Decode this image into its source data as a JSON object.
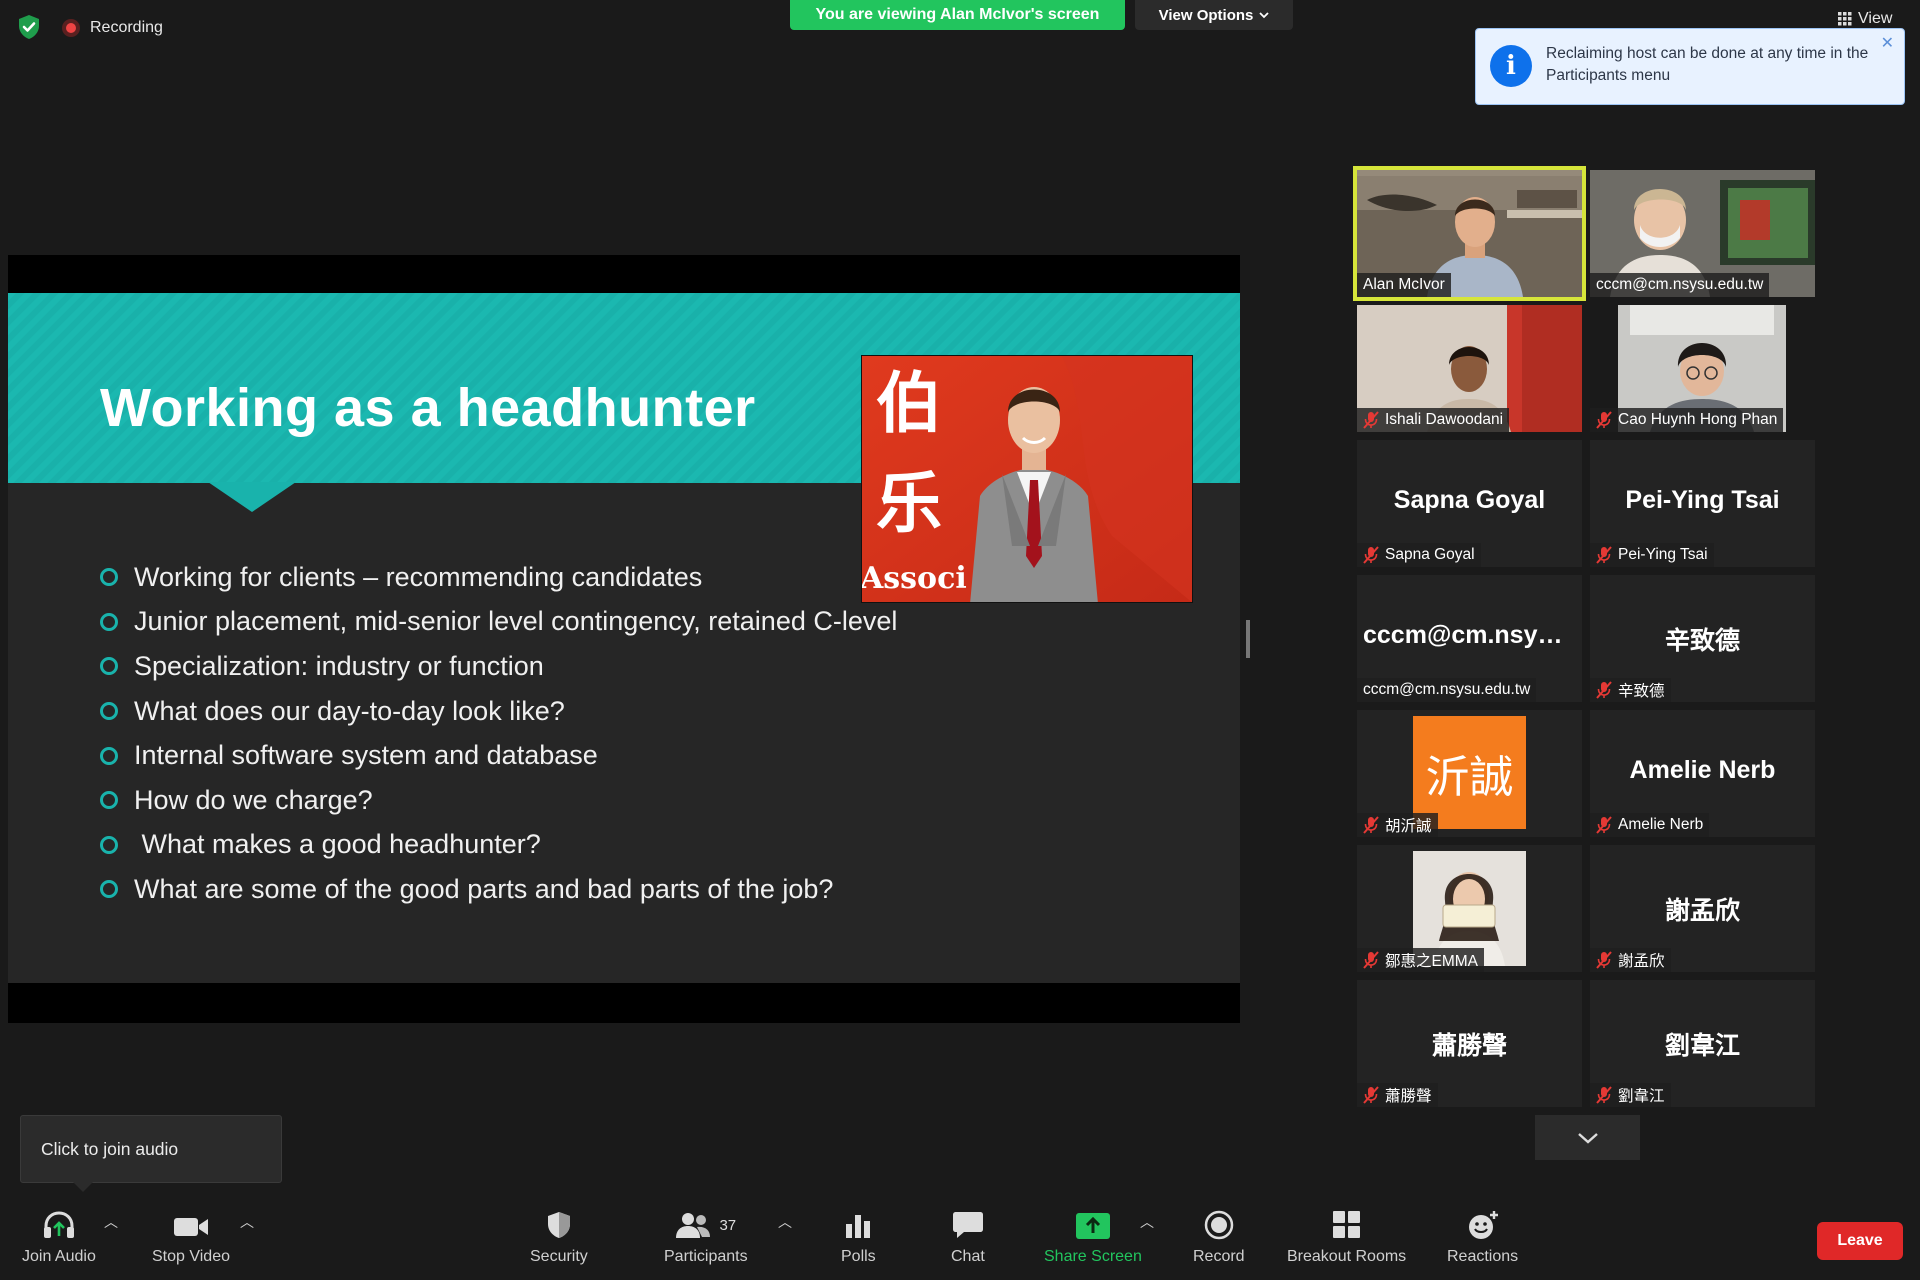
{
  "top_bar": {
    "recording_label": "Recording",
    "viewing_banner": "You are viewing Alan McIvor's screen",
    "view_options_label": "View Options",
    "view_label": "View"
  },
  "toast": {
    "message": "Reclaiming host can be done at any time in the Participants menu",
    "icon": "info-icon"
  },
  "slide": {
    "title": "Working as a headhunter",
    "photo_text_top": "伯",
    "photo_text_mid": "乐",
    "photo_text_bottom": "Associ",
    "bullets": [
      "Working for clients – recommending candidates",
      "Junior placement, mid-senior level contingency, retained C-level",
      "Specialization: industry or function",
      "What does our day-to-day look like?",
      "Internal software system and database",
      "How do we charge?",
      " What makes a good headhunter?",
      "What are some of the good parts and bad parts of the job?"
    ]
  },
  "participants": [
    {
      "label": "Alan McIvor",
      "big": "",
      "muted": false,
      "kind": "video-man"
    },
    {
      "label": "cccm@cm.nsysu.edu.tw",
      "big": "",
      "muted": false,
      "kind": "video-masked"
    },
    {
      "label": "Ishali Dawoodani",
      "big": "",
      "muted": true,
      "kind": "video-woman"
    },
    {
      "label": "Cao Huynh Hong Phan",
      "big": "",
      "muted": true,
      "kind": "video-glasses"
    },
    {
      "label": "Sapna Goyal",
      "big": "Sapna Goyal",
      "muted": true,
      "kind": "name"
    },
    {
      "label": "Pei-Ying Tsai",
      "big": "Pei-Ying Tsai",
      "muted": true,
      "kind": "name"
    },
    {
      "label": "cccm@cm.nsysu.edu.tw",
      "big": "cccm@cm.nsysu...",
      "muted": false,
      "kind": "name"
    },
    {
      "label": "辛致德",
      "big": "辛致德",
      "muted": true,
      "kind": "name"
    },
    {
      "label": "胡沂誠",
      "big": "沂誠",
      "muted": true,
      "kind": "avatar-orange"
    },
    {
      "label": "Amelie Nerb",
      "big": "Amelie Nerb",
      "muted": true,
      "kind": "name"
    },
    {
      "label": "鄒惠之EMMA",
      "big": "",
      "muted": true,
      "kind": "avatar-photo"
    },
    {
      "label": "謝孟欣",
      "big": "謝孟欣",
      "muted": true,
      "kind": "name"
    },
    {
      "label": "蕭勝聲",
      "big": "蕭勝聲",
      "muted": true,
      "kind": "name"
    },
    {
      "label": "劉韋江",
      "big": "劉韋江",
      "muted": true,
      "kind": "name"
    }
  ],
  "tooltip": {
    "text": "Click to join audio"
  },
  "toolbar": {
    "join_audio": "Join Audio",
    "stop_video": "Stop Video",
    "security": "Security",
    "participants": "Participants",
    "participants_count": "37",
    "polls": "Polls",
    "chat": "Chat",
    "share_screen": "Share Screen",
    "record": "Record",
    "breakout_rooms": "Breakout Rooms",
    "reactions": "Reactions",
    "leave": "Leave"
  },
  "colors": {
    "accent_green": "#22c55e",
    "slide_teal": "#19b3ac",
    "leave_red": "#e02828",
    "active_speaker": "#d6e53a",
    "toast_blue": "#0e71eb",
    "avatar_orange": "#f47c1e"
  }
}
